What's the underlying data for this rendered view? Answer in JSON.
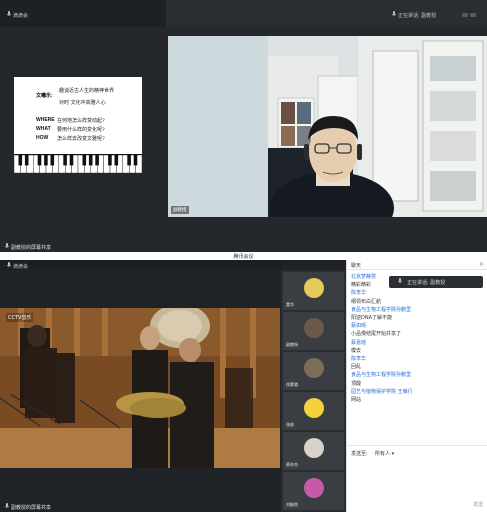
{
  "top_window": {
    "left_title": "滴滴会",
    "speaking": "正在讲话: 副教授",
    "slide": {
      "key_line1": "文曦乐:",
      "sub1": "趣谈近古人生的精神世界",
      "sub2": "对时 文化中高雅人心",
      "rows": [
        {
          "key": "WHERE",
          "text": "在何地怎么样变动起?"
        },
        {
          "key": "WHAT",
          "text": "要用什么样的变化呢?"
        },
        {
          "key": "HOW",
          "text": "怎么样去改变文雅呢?"
        }
      ]
    },
    "cam_name": "副教授",
    "share_label": "副教授的屏幕共享"
  },
  "bottom_window": {
    "title": "腾讯会议",
    "left_title": "滴滴会",
    "stage_label": "副教授的屏幕共享",
    "watermark_left": "CCTV音乐",
    "participants": [
      {
        "name": "董华",
        "color": "#e7c95a"
      },
      {
        "name": "副教授",
        "color": "#6b5a4a"
      },
      {
        "name": "徐蒙璐",
        "color": "#7d6e5a"
      },
      {
        "name": "张俊",
        "color": "#f4d23e"
      },
      {
        "name": "蔡亦杰",
        "color": "#d9d2c8"
      },
      {
        "name": "刘楷然",
        "color": "#c65aa8"
      }
    ]
  },
  "chat": {
    "title": "聊天",
    "speak_banner": "正在讲话: 副教授",
    "messages": [
      {
        "type": "name",
        "text": "北京梦静慧"
      },
      {
        "type": "text",
        "text": "精彩精彩"
      },
      {
        "type": "name",
        "text": "陈李华"
      },
      {
        "type": "text",
        "text": "纲领布白汇航"
      },
      {
        "type": "name",
        "text": "食品与生物工程学院孙鹏里"
      },
      {
        "type": "text",
        "text": "阳逆DNA了解不旋"
      },
      {
        "type": "name",
        "text": "蔡如晴"
      },
      {
        "type": "text",
        "text": "小品慢结尾开始并享了"
      },
      {
        "type": "name",
        "text": "蔡嘉瑶"
      },
      {
        "type": "text",
        "text": "模去"
      },
      {
        "type": "name",
        "text": "陈李华"
      },
      {
        "type": "text",
        "text": "回乱"
      },
      {
        "type": "name",
        "text": "食品与生物工程学院孙鹏里"
      },
      {
        "type": "text",
        "text": "顶酸"
      },
      {
        "type": "name",
        "text": "园艺与植物保护学院 王萌行"
      },
      {
        "type": "text",
        "text": "网站"
      }
    ],
    "send_label": "发送至:",
    "send_target": "所有人 ▾",
    "send_button": "发送"
  },
  "colors": {
    "chat_name": "#2b6fd6",
    "panel_bg": "#24272b"
  }
}
